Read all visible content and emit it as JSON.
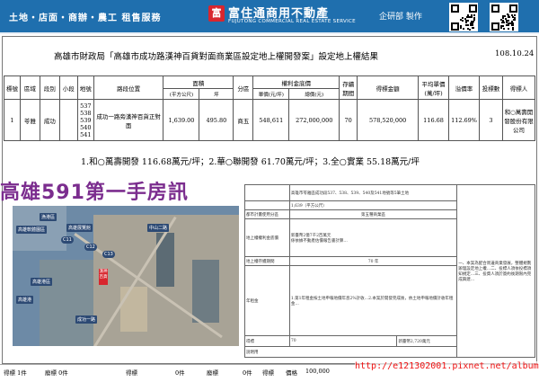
{
  "header": {
    "left_text": "土地・店面・商辦・農工 租售服務",
    "logo_mark": "富",
    "logo_name": "富住通商用不動產",
    "logo_sub": "FUJUTONG COMMERCIAL REAL ESTATE SERVICE",
    "dept": "企研部 製作",
    "brand_color": "#1f6fae"
  },
  "doc": {
    "title": "高雄市財政局「高雄市成功路漢神百貨對面商業區設定地上權開發案」設定地上權結果",
    "date": "108.10.24",
    "table": {
      "h_no": "標號",
      "h_district": "區域",
      "h_section": "段別",
      "h_subsection": "小段",
      "h_lot": "地號",
      "h_location": "路段位置",
      "h_area": "面積",
      "h_area_m2": "(平方公尺)",
      "h_area_ping": "坪",
      "h_zoning": "分區",
      "h_reserve": "權利金底價",
      "h_unit": "單價(元/坪)",
      "h_total": "總價(元)",
      "h_years": "存續期間",
      "h_bid": "得標金額",
      "h_avg": "平均單價(萬/坪)",
      "h_avg_sub": "(萬/坪)",
      "h_premium": "溢價率",
      "h_bids": "投標數",
      "h_winner": "得標人",
      "row": {
        "no": "1",
        "district": "苓雅",
        "section": "成功",
        "lots": [
          "537",
          "538",
          "539",
          "540",
          "541"
        ],
        "location": "成功一路旁漢神百貨正對面",
        "area_m2": "1,639.00",
        "area_ping": "495.80",
        "zoning": "商五",
        "unit_price": "548,611",
        "total_price": "272,000,000",
        "years": "70",
        "bid_amount": "578,520,000",
        "avg_price": "116.68",
        "premium": "112.69%",
        "bids": "3",
        "winner": "和○萬壽開發股份有限公司"
      }
    },
    "summary": "1.和○萬壽開發 116.68萬元/坪；2.華○聯開發 61.70萬元/坪；3.全○實業 55.18萬元/坪"
  },
  "watermark": "高雄591第一手房訊",
  "map": {
    "labels": [
      "漁港區",
      "高雄展覽館",
      "高雄軟體園區",
      "C11",
      "C12",
      "C13",
      "高雄港區",
      "高雄港",
      "中山二路",
      "成功一路"
    ],
    "pin_label": "漢神百貨"
  },
  "conditions": {
    "row1_label": "",
    "row1_text": "高雄市苓雅區成功段537、538、539、540及541地號等5筆土地",
    "row2_label": "",
    "row2_text": "1,639（平方公尺）",
    "row3_label": "都市計畫使用分區",
    "row3_text": "第五種商業區",
    "row4_label": "",
    "row4_text": "新臺幣2億7千2百萬元",
    "row5_label": "地上權權利金底價",
    "row5_text": "係依據不動產估價報告書計算…",
    "row6_label": "地上權存續期間",
    "row6_text": "70 年",
    "row7_label": "年租金",
    "row7_text": "1.第1年租金按土地申報地價年息2%計收…2.本案於開發完成後，依土地申報地價計收年租金…",
    "side_text": "一、本案為配合周邊商業發展，整體規劃辦理設定地上權…二、投標人須依投標須知規定…三、投資人須於簽約後期限內完成興建…",
    "side_label": "說明用",
    "bottom_left": "得標",
    "bottom_num": "70",
    "bottom_right": "新臺幣2,720萬元"
  },
  "footer": {
    "items": [
      "得標 1件",
      "廢標 0件",
      "得標",
      "0件",
      "廢標",
      "0件",
      "得標",
      "價格",
      "100,000"
    ],
    "url": "http://e121302001.pixnet.net/album"
  }
}
